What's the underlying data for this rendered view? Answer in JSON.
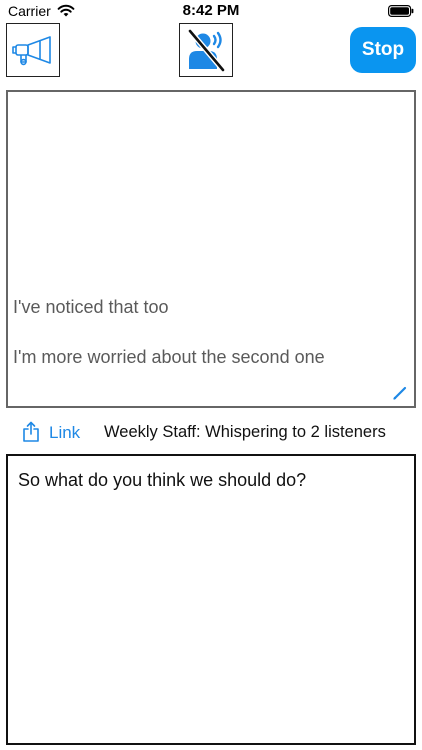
{
  "status_bar": {
    "carrier": "Carrier",
    "time": "8:42 PM"
  },
  "toolbar": {
    "horn_icon": "horn-icon",
    "speaker_icon": "speaking-muted-icon",
    "stop_label": "Stop"
  },
  "transcript": {
    "lines": [
      "I've noticed that too",
      "I'm more worried about the second one"
    ],
    "edit_icon": "pencil-icon"
  },
  "share": {
    "link_label": "Link",
    "status": "Weekly Staff: Whispering to 2 listeners"
  },
  "compose": {
    "text": "So what do you think we should do?"
  },
  "colors": {
    "accent": "#0A95F0",
    "link": "#1E88E5"
  }
}
